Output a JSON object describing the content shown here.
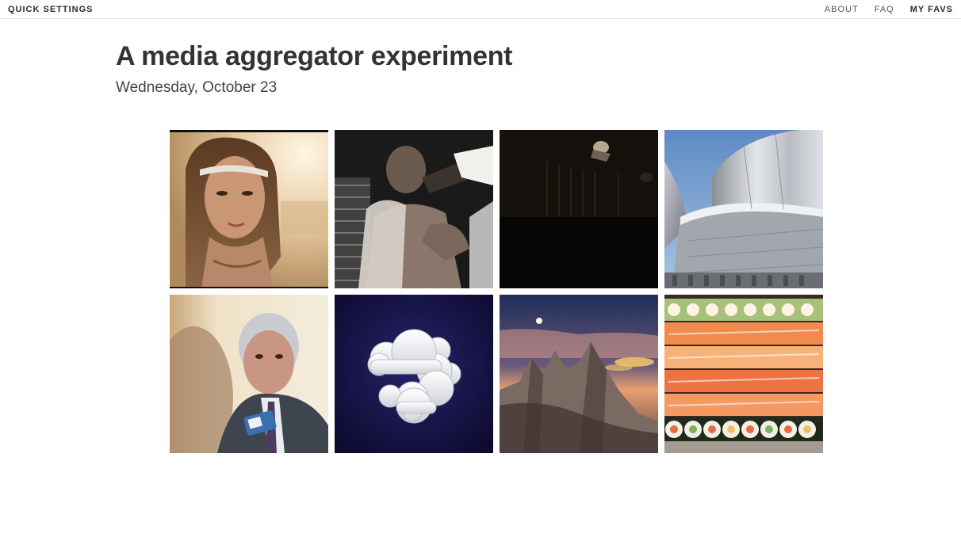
{
  "topbar": {
    "quick_settings": "QUICK SETTINGS",
    "nav": [
      {
        "label": "ABOUT",
        "bold": false
      },
      {
        "label": "FAQ",
        "bold": false
      },
      {
        "label": "MY FAVS",
        "bold": true
      }
    ]
  },
  "page": {
    "title": "A media aggregator experiment",
    "date": "Wednesday, October 23"
  },
  "media_tiles": [
    {
      "subject": "woman-with-headband-photo",
      "selected": true
    },
    {
      "subject": "man-drinking-from-bottle-photo",
      "selected": false
    },
    {
      "subject": "dark-night-scene-photo",
      "selected": false
    },
    {
      "subject": "metallic-building-photo",
      "selected": false
    },
    {
      "subject": "man-being-interviewed-photo",
      "selected": false
    },
    {
      "subject": "weather-clouds-icon",
      "selected": false
    },
    {
      "subject": "mountain-peaks-above-clouds-photo",
      "selected": false
    },
    {
      "subject": "sushi-platter-photo",
      "selected": false
    }
  ]
}
